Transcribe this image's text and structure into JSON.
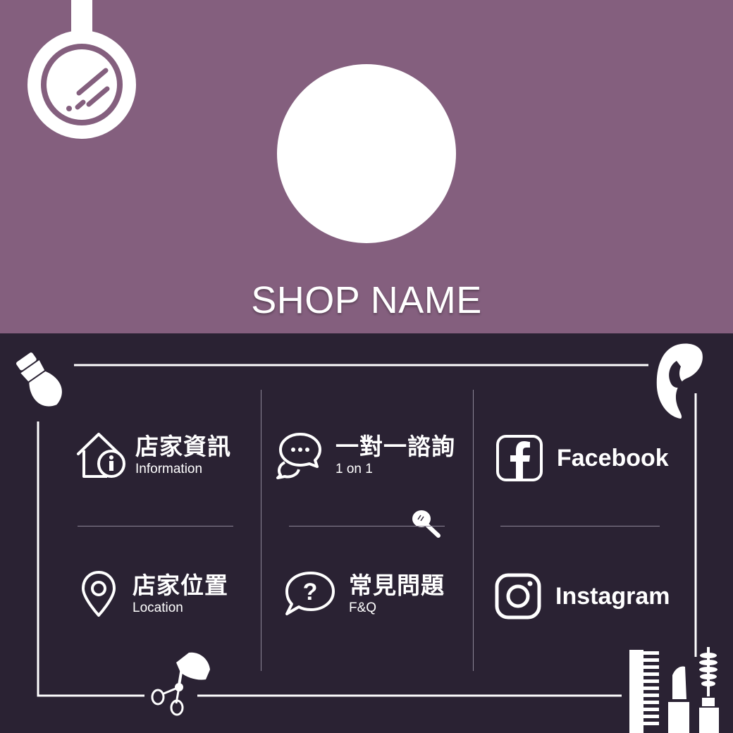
{
  "colors": {
    "header_bg": "#845f7e",
    "body_bg": "#2a2233",
    "line": "#ffffff",
    "divider": "#8d8697"
  },
  "header": {
    "shop_name": "SHOP NAME"
  },
  "menu": [
    {
      "icon": "house-info-icon",
      "title": "店家資訊",
      "subtitle": "Information"
    },
    {
      "icon": "chat-bubbles-icon",
      "title": "一對一諮詢",
      "subtitle": "1 on 1"
    },
    {
      "icon": "facebook-icon",
      "title": "Facebook"
    },
    {
      "icon": "location-pin-icon",
      "title": "店家位置",
      "subtitle": "Location"
    },
    {
      "icon": "question-bubble-icon",
      "title": "常見問題",
      "subtitle": "F&Q"
    },
    {
      "icon": "instagram-icon",
      "title": "Instagram"
    }
  ]
}
